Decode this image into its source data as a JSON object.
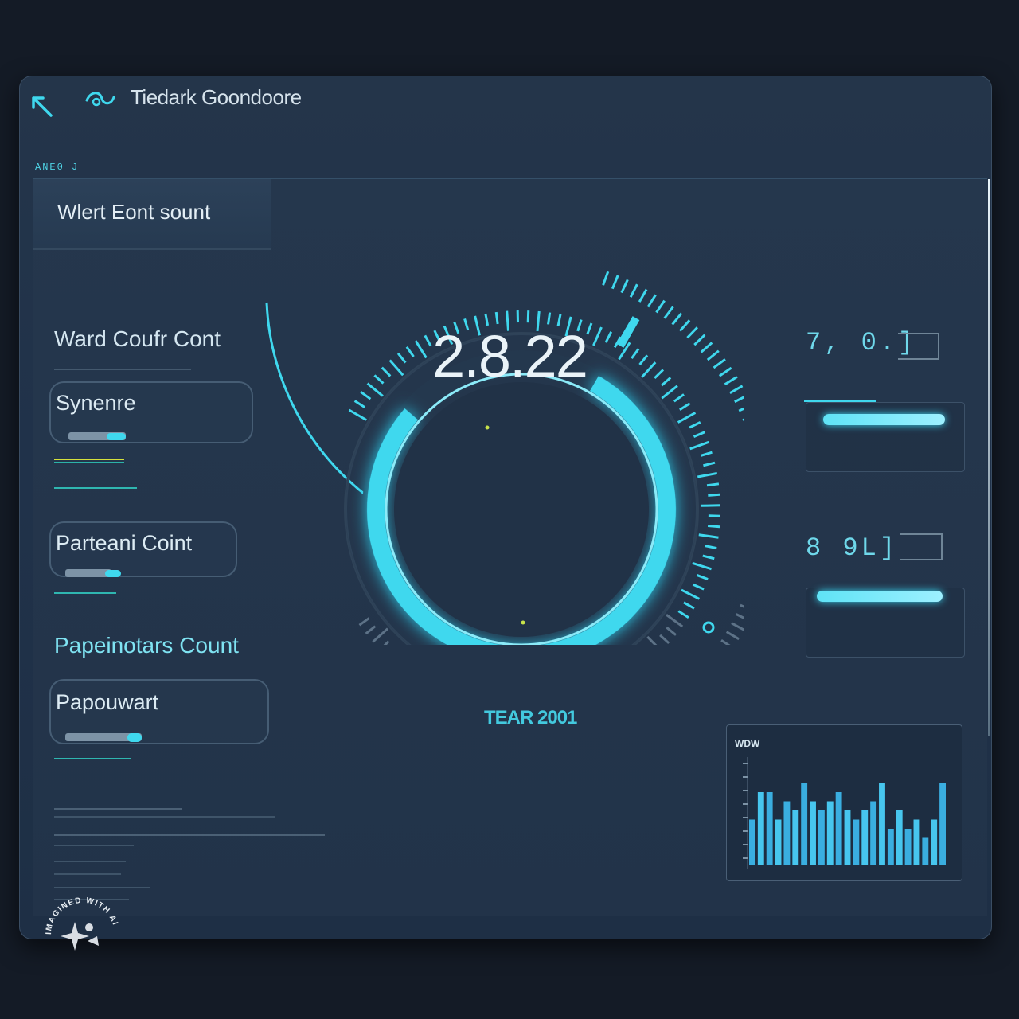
{
  "window": {
    "title": "Tiedark Goondoore",
    "tag": "ANE0 J"
  },
  "header": {
    "title": "Wlert Eont sount"
  },
  "left_panel": {
    "section_1_label": "Ward Coufr Cont",
    "item_1_label": "Synenre",
    "item_2_label": "Parteani Coint",
    "section_2_label": "Papeinotars Count",
    "item_3_label": "Papouwart"
  },
  "gauge": {
    "value": "2.8.22",
    "sub_label": "TEAR 2001",
    "level": 0.78
  },
  "right_panel": {
    "readout_1": "7, 0.]",
    "readout_2": "8 9L]",
    "slider_1_level": 0.9,
    "slider_2_level": 0.93
  },
  "chart_data": {
    "type": "bar",
    "title": "WDW",
    "values": [
      5,
      8,
      8,
      5,
      7,
      6,
      9,
      7,
      6,
      7,
      8,
      6,
      5,
      6,
      7,
      9,
      4,
      6,
      4,
      5,
      3,
      5,
      9
    ]
  },
  "watermark": {
    "text": "IMAGINED WITH AI"
  },
  "colors": {
    "accent": "#3fd8ee",
    "background": "#141b26",
    "panel": "#22344a"
  },
  "icons": {
    "back": "arrow-diagonal-icon",
    "logo": "swirl-logo-icon"
  }
}
